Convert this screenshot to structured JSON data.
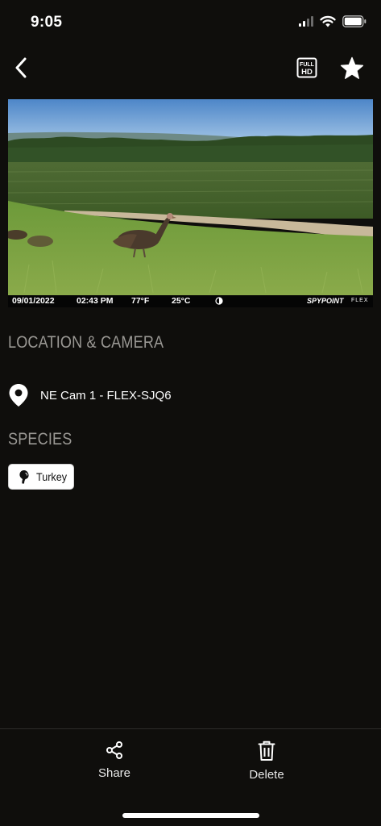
{
  "status_bar": {
    "time": "9:05",
    "icons": [
      "cellular-signal-icon",
      "wifi-icon",
      "battery-icon"
    ]
  },
  "nav": {
    "back_icon": "chevron-left-icon",
    "hd_icon": "full-hd-icon",
    "hd_icon_text_top": "FULL",
    "hd_icon_text_bottom": "HD",
    "favorite_icon": "star-icon"
  },
  "photo": {
    "date": "09/01/2022",
    "time": "02:43 PM",
    "temp_f": "77°F",
    "temp_c": "25°C",
    "moon_phase_icon": "moon-phase-icon",
    "brand": "SPYPOINT",
    "model": "FLEX"
  },
  "location_section": {
    "heading": "LOCATION & CAMERA",
    "icon": "location-pin-icon",
    "camera_name": "NE Cam 1 - FLEX-SJQ6"
  },
  "species_section": {
    "heading": "SPECIES",
    "tags": [
      {
        "icon": "turkey-icon",
        "label": "Turkey"
      }
    ]
  },
  "actions": {
    "share_label": "Share",
    "share_icon": "share-icon",
    "delete_label": "Delete",
    "delete_icon": "trash-icon"
  },
  "colors": {
    "background": "#0f0e0c",
    "heading": "#9a9894",
    "text": "#ffffff"
  }
}
